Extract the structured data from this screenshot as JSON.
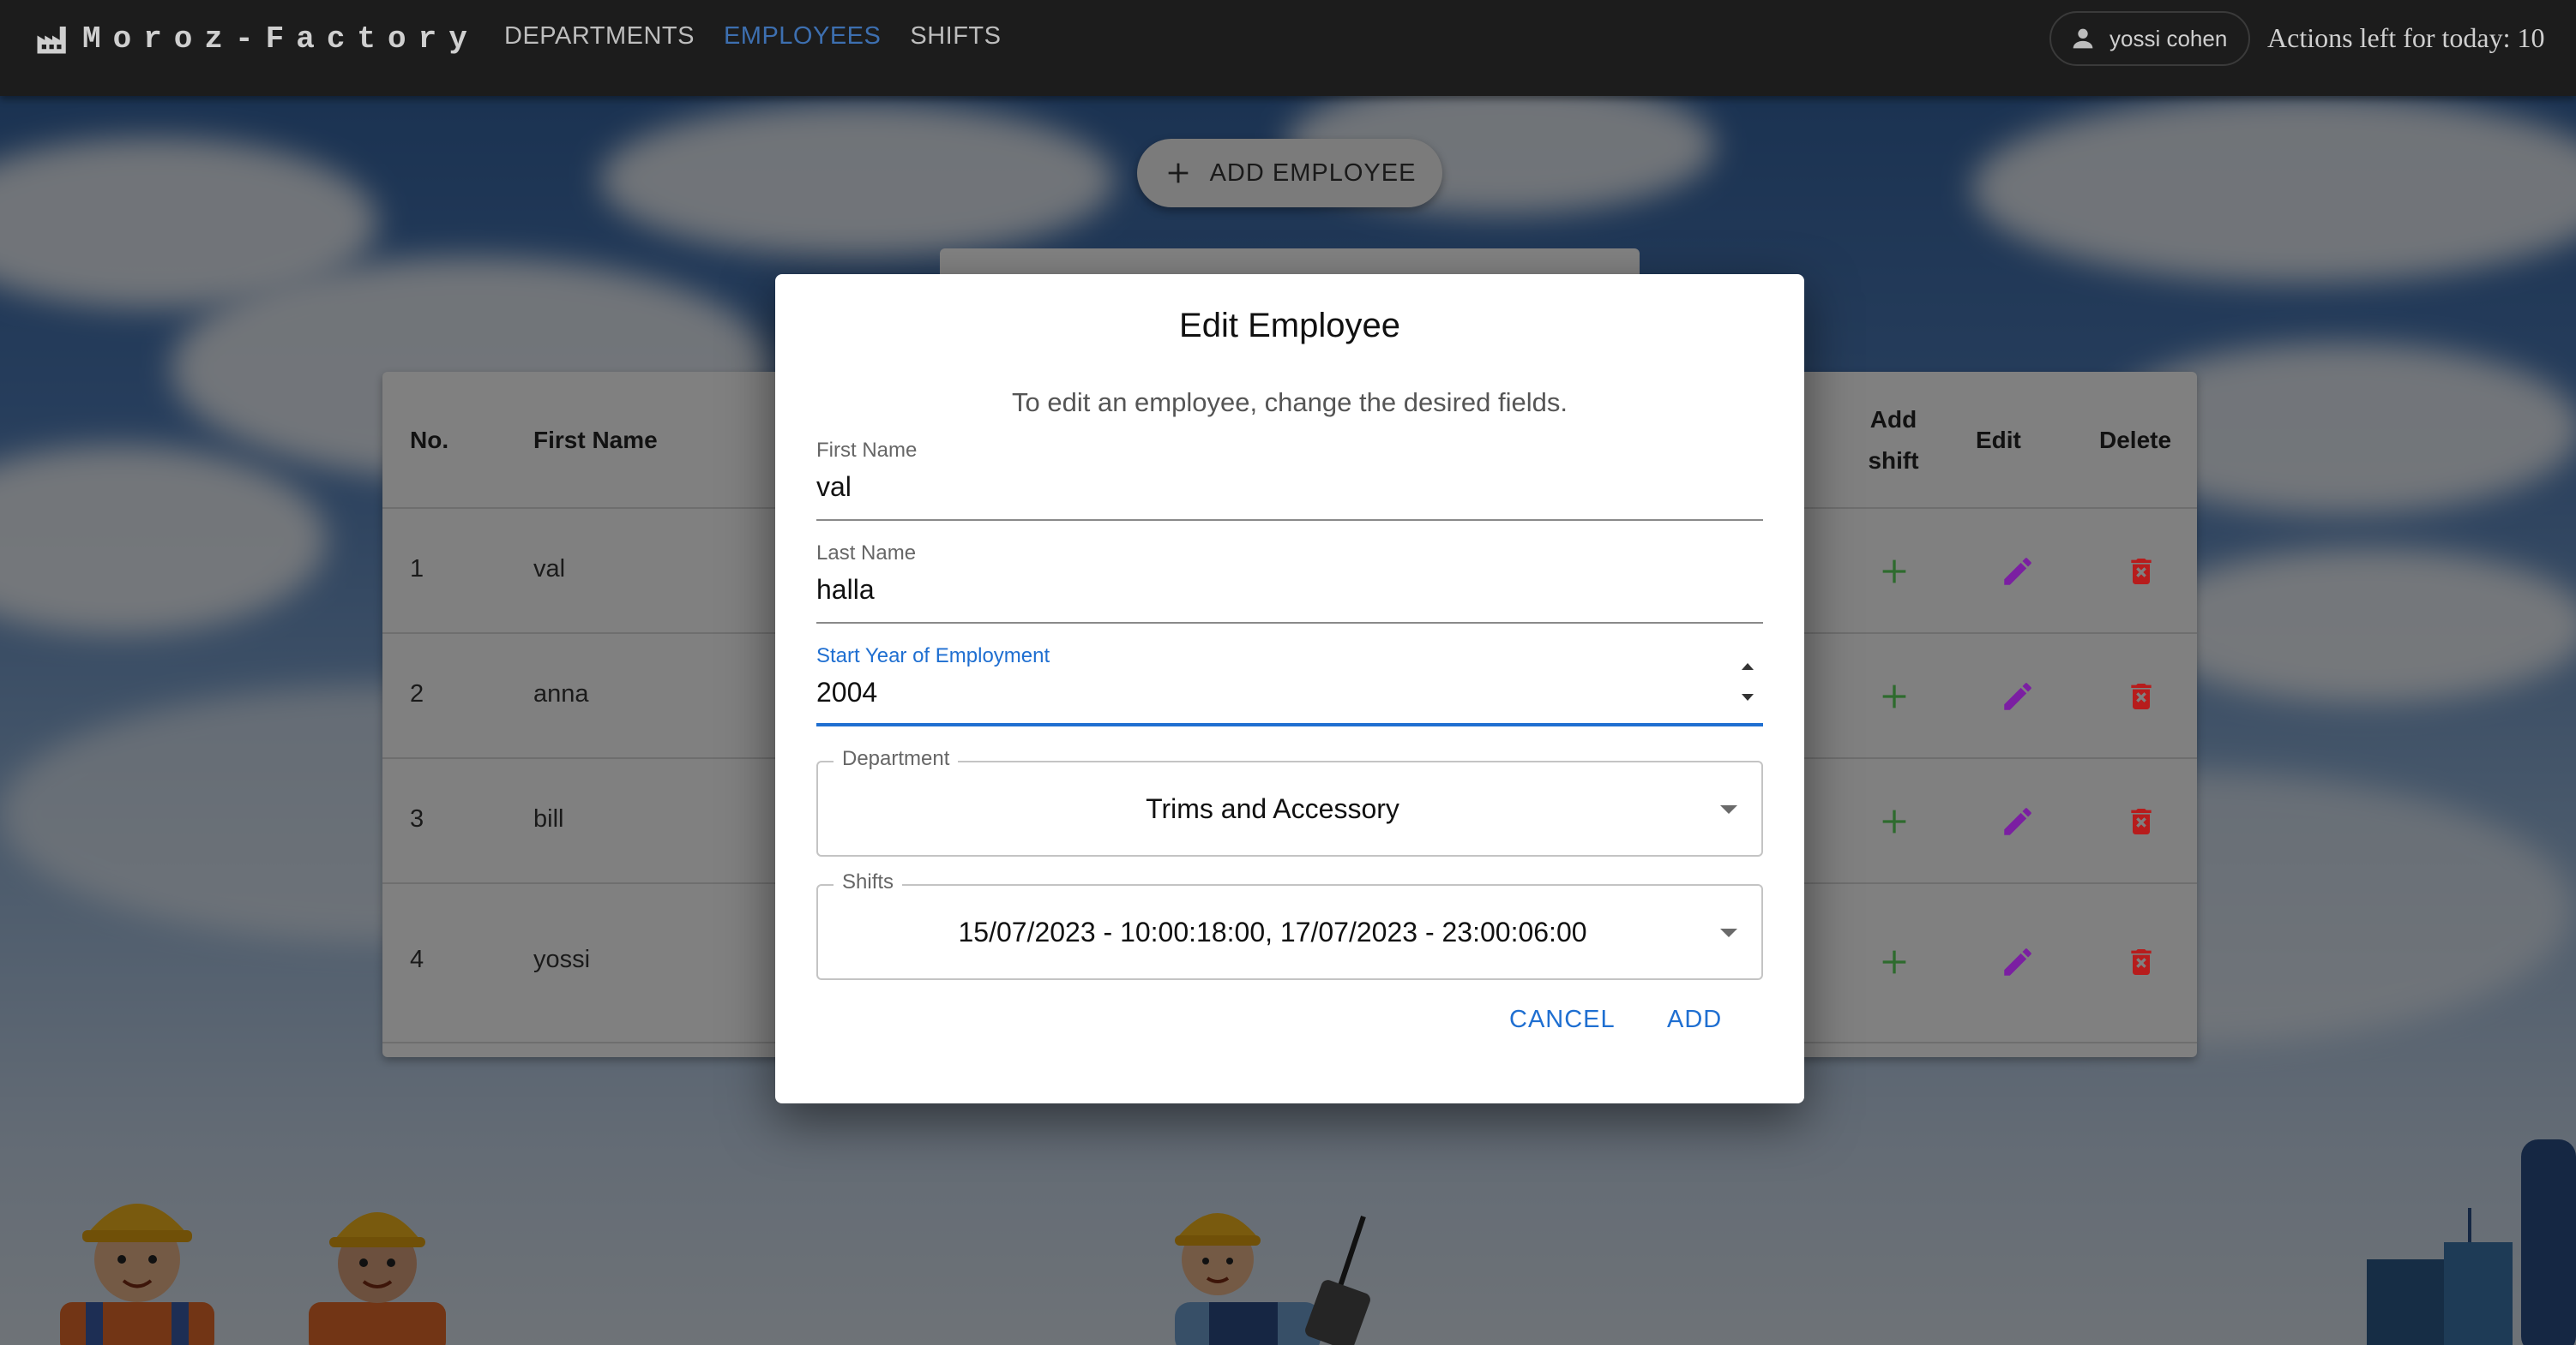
{
  "app": {
    "name": "Moroz-Factory"
  },
  "nav": {
    "links": [
      {
        "label": "DEPARTMENTS",
        "active": false
      },
      {
        "label": "EMPLOYEES",
        "active": true
      },
      {
        "label": "SHIFTS",
        "active": false
      }
    ],
    "user_name": "yossi cohen",
    "actions_left": "Actions left for today: 10"
  },
  "add_button": {
    "label": "ADD EMPLOYEE"
  },
  "table": {
    "headers": {
      "no": "No.",
      "first_name": "First Name",
      "add_shift_1": "Add",
      "add_shift_2": "shift",
      "edit": "Edit",
      "delete": "Delete"
    },
    "rows": [
      {
        "no": "1",
        "first_name": "val"
      },
      {
        "no": "2",
        "first_name": "anna"
      },
      {
        "no": "3",
        "first_name": "bill"
      },
      {
        "no": "4",
        "first_name": "yossi"
      }
    ]
  },
  "dialog": {
    "title": "Edit Employee",
    "subtitle": "To edit an employee, change the desired fields.",
    "first_name": {
      "label": "First Name",
      "value": "val"
    },
    "last_name": {
      "label": "Last Name",
      "value": "halla"
    },
    "start_year": {
      "label": "Start Year of Employment",
      "value": "2004"
    },
    "department": {
      "label": "Department",
      "value": "Trims and Accessory"
    },
    "shifts": {
      "label": "Shifts",
      "value": "15/07/2023 - 10:00:18:00, 17/07/2023 - 23:00:06:00"
    },
    "cancel_label": "CANCEL",
    "add_label": "ADD"
  },
  "colors": {
    "navbar": "#1c1c1c",
    "active_link": "#3d6fb0",
    "primary": "#1f6fd1",
    "add_shift_icon": "#2e6b2e",
    "edit_icon": "#7b1fa2",
    "delete_icon": "#b71c1c"
  },
  "icons": {
    "logo": "factory-icon",
    "user": "person-icon",
    "add": "plus-icon",
    "edit": "pencil-icon",
    "delete": "trash-icon",
    "dropdown": "caret-down-icon"
  }
}
